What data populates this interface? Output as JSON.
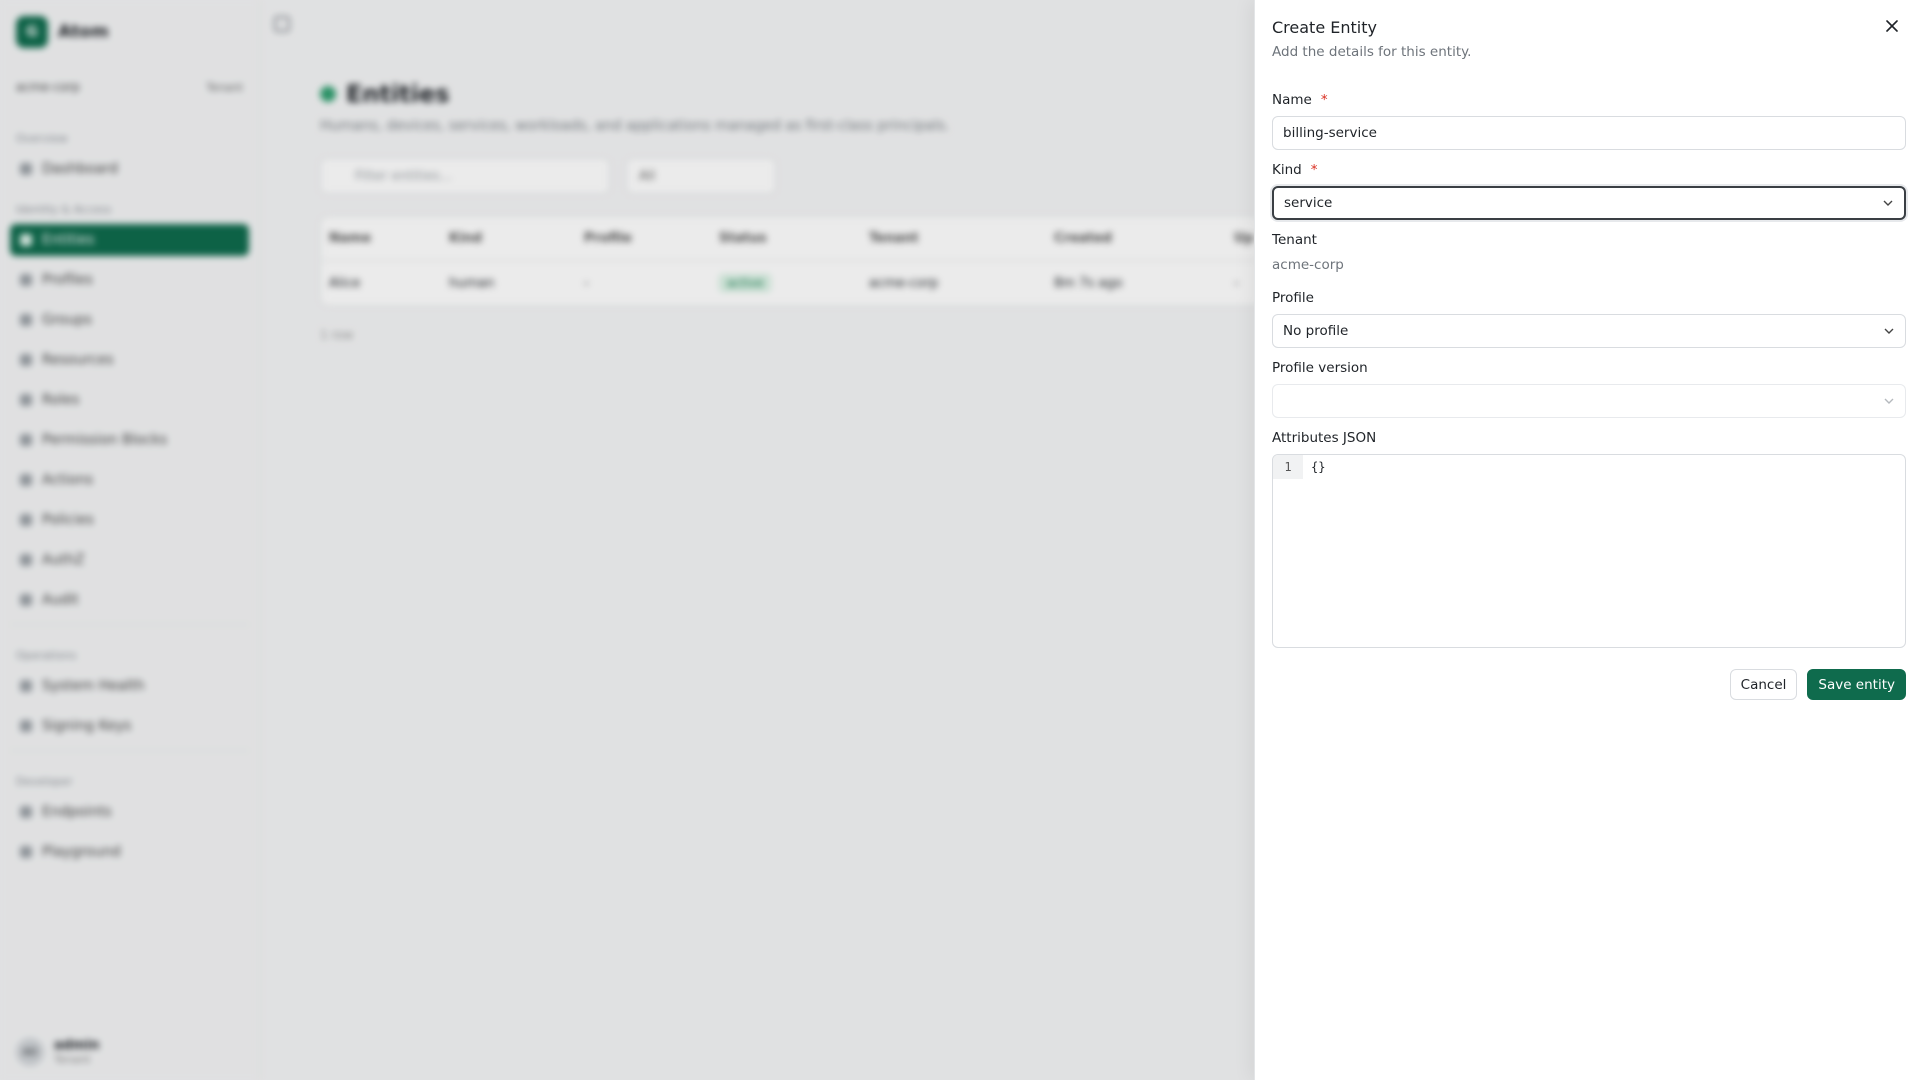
{
  "background": {
    "brand": {
      "mark": "G",
      "name": "Atom"
    },
    "tenant": {
      "name": "acme-corp",
      "switch_label": "Tenant"
    },
    "nav": [
      {
        "type": "group",
        "label": "Overview"
      },
      {
        "type": "item",
        "label": "Dashboard"
      },
      {
        "type": "group",
        "label": "Identity & Access"
      },
      {
        "type": "item",
        "label": "Entities",
        "active": true
      },
      {
        "type": "item",
        "label": "Profiles"
      },
      {
        "type": "item",
        "label": "Groups"
      },
      {
        "type": "item",
        "label": "Resources"
      },
      {
        "type": "item",
        "label": "Roles"
      },
      {
        "type": "item",
        "label": "Permission Blocks"
      },
      {
        "type": "item",
        "label": "Actions"
      },
      {
        "type": "item",
        "label": "Policies"
      },
      {
        "type": "item",
        "label": "AuthZ"
      },
      {
        "type": "item",
        "label": "Audit"
      },
      {
        "type": "group",
        "label": "Operations"
      },
      {
        "type": "item",
        "label": "System Health"
      },
      {
        "type": "item",
        "label": "Signing Keys"
      },
      {
        "type": "group",
        "label": "Developer"
      },
      {
        "type": "item",
        "label": "Endpoints"
      },
      {
        "type": "item",
        "label": "Playground"
      }
    ],
    "user": {
      "initials": "AD",
      "name": "admin",
      "role": "Tenant"
    },
    "page": {
      "title": "Entities",
      "subtitle": "Humans, devices, services, workloads, and applications managed as first-class principals.",
      "filter_placeholder": "Filter entities...",
      "filter_kind": "All",
      "columns": [
        "Name",
        "Kind",
        "Profile",
        "Status",
        "Tenant",
        "Created",
        "Up"
      ],
      "rows": [
        [
          "Alice",
          "human",
          "-",
          "active",
          "acme-corp",
          "8m 7s ago",
          "-"
        ]
      ],
      "row_count": "1 row"
    }
  },
  "drawer": {
    "title": "Create Entity",
    "description": "Add the details for this entity.",
    "close_icon": "close-icon",
    "fields": {
      "name": {
        "label": "Name",
        "required_mark": "*",
        "value": "billing-service"
      },
      "kind": {
        "label": "Kind",
        "required_mark": "*",
        "value": "service"
      },
      "tenant": {
        "label": "Tenant",
        "value": "acme-corp"
      },
      "profile": {
        "label": "Profile",
        "value": "No profile"
      },
      "profile_version": {
        "label": "Profile version",
        "value": ""
      },
      "attributes": {
        "label": "Attributes JSON",
        "line_number": "1",
        "code": "{}"
      }
    },
    "buttons": {
      "cancel": "Cancel",
      "save": "Save entity"
    }
  },
  "colors": {
    "accent": "#0f6b4d",
    "required": "#d92d20",
    "status_active_bg": "#d9f2e4"
  }
}
